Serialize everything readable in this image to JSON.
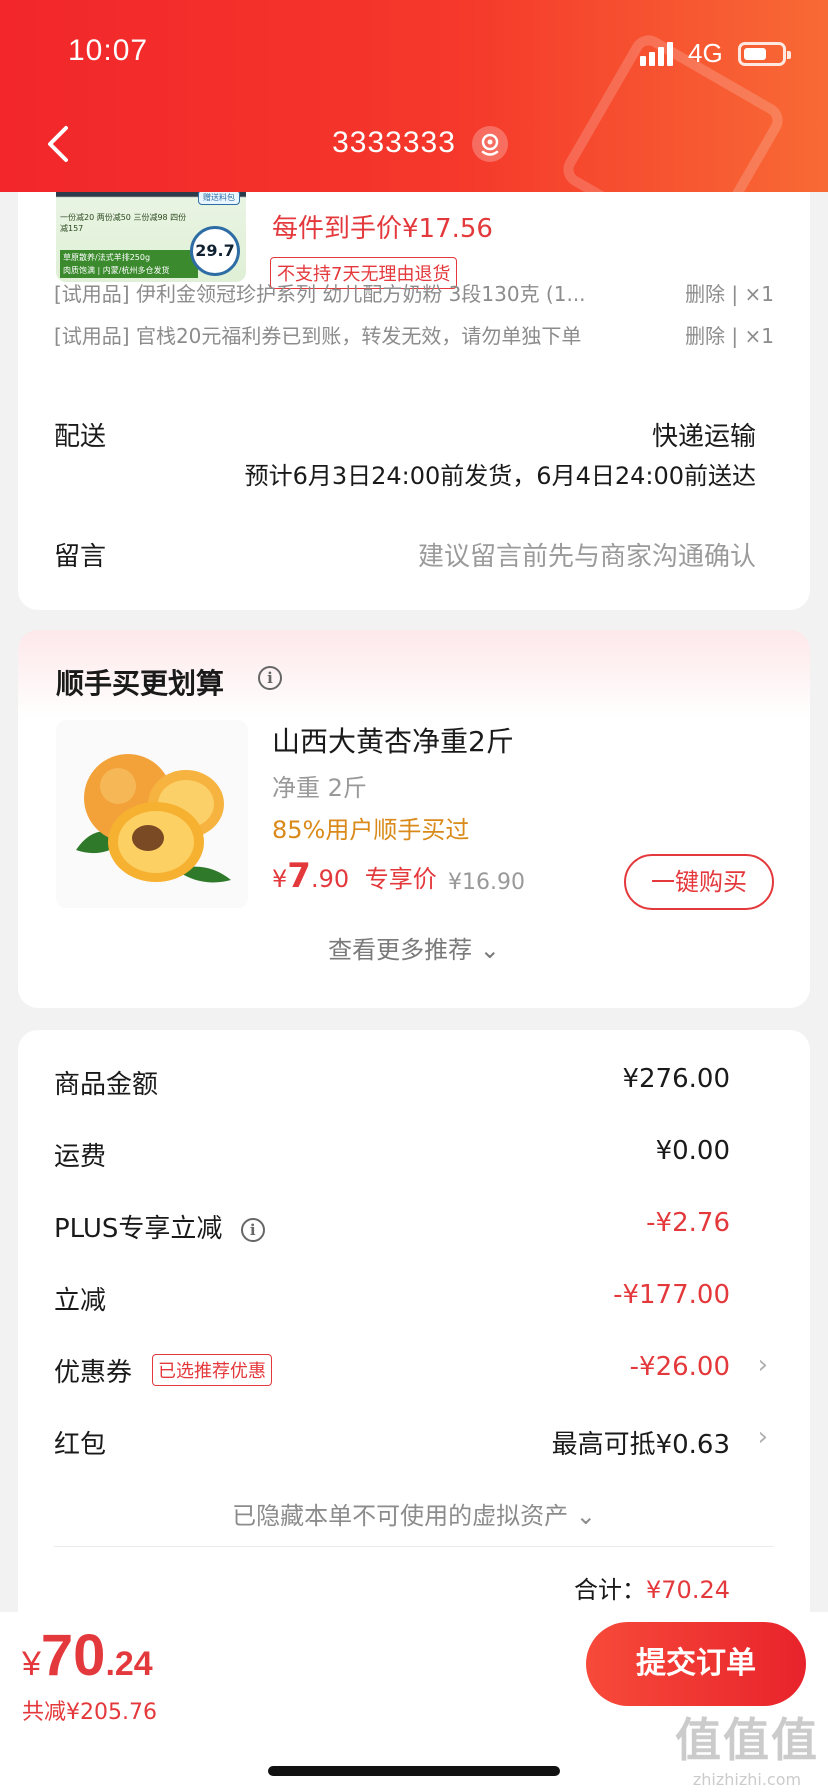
{
  "status_bar": {
    "time": "10:07",
    "network": "4G"
  },
  "nav": {
    "title": "3333333"
  },
  "product": {
    "thumb_promo": "一份减20 两份减50 三份减98 四份减157",
    "thumb_bar": "草原散养/法式羊排250g\n肉质饱满 | 内蒙/杭州多仓发货",
    "thumb_tag": "赠送料包",
    "thumb_price": "29.7",
    "price_text": "每件到手价¥17.56",
    "return_badge": "不支持7天无理由退货"
  },
  "trial_items": [
    {
      "text": "[试用品] 伊利金领冠珍护系列 幼儿配方奶粉 3段130克 (1...",
      "action": "删除 | ×1"
    },
    {
      "text": "[试用品] 官栈20元福利券已到账，转发无效，请勿单独下单",
      "action": "删除 | ×1"
    }
  ],
  "delivery": {
    "label": "配送",
    "method": "快递运输",
    "estimate": "预计6月3日24:00前发货，6月4日24:00前送达"
  },
  "message": {
    "label": "留言",
    "placeholder": "建议留言前先与商家沟通确认"
  },
  "recommend": {
    "section_title": "顺手买更划算",
    "title": "山西大黄杏净重2斤",
    "spec": "净重 2斤",
    "social": "85%用户顺手买过",
    "price_symbol": "¥",
    "price_int": "7",
    "price_dec": ".90",
    "price_tag": "专享价",
    "old_price": "¥16.90",
    "buy_label": "一键购买",
    "more_label": "查看更多推荐 ⌄"
  },
  "fees": {
    "goods_label": "商品金额",
    "goods_value": "¥276.00",
    "shipping_label": "运费",
    "shipping_value": "¥0.00",
    "plus_label": "PLUS专享立减",
    "plus_value": "-¥2.76",
    "discount_label": "立减",
    "discount_value": "-¥177.00",
    "coupon_label": "优惠券",
    "coupon_badge": "已选推荐优惠",
    "coupon_value": "-¥26.00",
    "redpacket_label": "红包",
    "redpacket_value": "最高可抵¥0.63",
    "hidden_assets": "已隐藏本单不可使用的虚拟资产 ⌄",
    "total_label": "合计：",
    "total_value": "¥70.24"
  },
  "bottom": {
    "cur": "¥",
    "int": "70",
    "dec": ".24",
    "saved": "共减¥205.76",
    "submit_label": "提交订单"
  },
  "watermark": {
    "main": "值值值",
    "sub": "zhizhizhi.com"
  },
  "colors": {
    "brand_red": "#e4393c",
    "header_start": "#f2262b",
    "header_end": "#f86a35",
    "social_orange": "#d98a1a"
  }
}
